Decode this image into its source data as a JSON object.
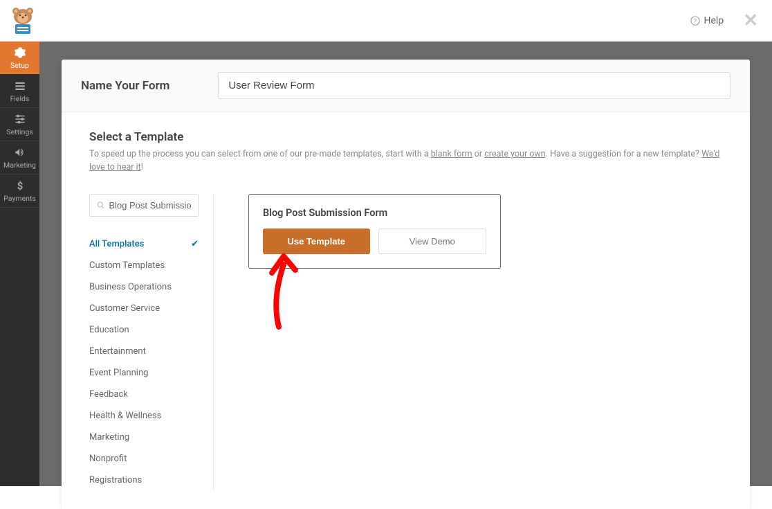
{
  "header": {
    "help_label": "Help"
  },
  "sidebar": {
    "items": [
      {
        "label": "Setup",
        "icon": "gear-icon",
        "active": true
      },
      {
        "label": "Fields",
        "icon": "list-icon",
        "active": false
      },
      {
        "label": "Settings",
        "icon": "sliders-icon",
        "active": false
      },
      {
        "label": "Marketing",
        "icon": "bullhorn-icon",
        "active": false
      },
      {
        "label": "Payments",
        "icon": "dollar-icon",
        "active": false
      }
    ]
  },
  "name_row": {
    "label": "Name Your Form",
    "value": "User Review Form"
  },
  "template_section": {
    "title": "Select a Template",
    "desc_prefix": "To speed up the process you can select from one of our pre-made templates, start with a ",
    "blank_form_link": "blank form",
    "desc_or": " or ",
    "create_own_link": "create your own",
    "desc_mid": ". Have a suggestion for a new template? ",
    "love_hear_link": "We'd love to hear it",
    "desc_end": "!"
  },
  "search": {
    "value": "Blog Post Submission"
  },
  "categories": [
    {
      "label": "All Templates",
      "active": true
    },
    {
      "label": "Custom Templates",
      "active": false
    },
    {
      "label": "Business Operations",
      "active": false
    },
    {
      "label": "Customer Service",
      "active": false
    },
    {
      "label": "Education",
      "active": false
    },
    {
      "label": "Entertainment",
      "active": false
    },
    {
      "label": "Event Planning",
      "active": false
    },
    {
      "label": "Feedback",
      "active": false
    },
    {
      "label": "Health & Wellness",
      "active": false
    },
    {
      "label": "Marketing",
      "active": false
    },
    {
      "label": "Nonprofit",
      "active": false
    },
    {
      "label": "Registrations",
      "active": false
    }
  ],
  "template_card": {
    "title": "Blog Post Submission Form",
    "use_label": "Use Template",
    "demo_label": "View Demo"
  }
}
